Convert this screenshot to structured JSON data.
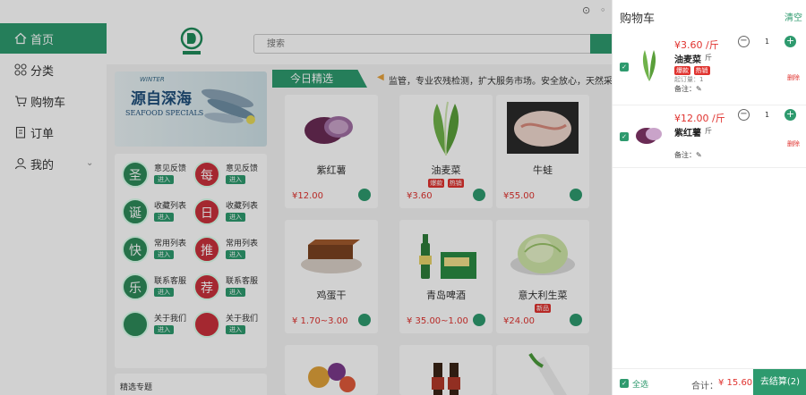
{
  "nav": {
    "items": [
      {
        "label": "首页",
        "icon": "home-icon"
      },
      {
        "label": "分类",
        "icon": "grid-icon"
      },
      {
        "label": "购物车",
        "icon": "cart-icon"
      },
      {
        "label": "订单",
        "icon": "order-icon"
      },
      {
        "label": "我的",
        "icon": "user-icon"
      }
    ]
  },
  "header": {
    "search_placeholder": "搜索"
  },
  "banner": {
    "subtitle": "WINTER",
    "title": "源自深海",
    "caption": "SEAFOOD SPECIALS"
  },
  "services": [
    {
      "label": "意见反馈",
      "char": "圣",
      "enter": "进入"
    },
    {
      "label": "意见反馈",
      "char": "每",
      "enter": "进入"
    },
    {
      "label": "收藏列表",
      "char": "诞",
      "enter": "进入"
    },
    {
      "label": "收藏列表",
      "char": "日",
      "enter": "进入"
    },
    {
      "label": "常用列表",
      "char": "快",
      "enter": "进入"
    },
    {
      "label": "常用列表",
      "char": "推",
      "enter": "进入"
    },
    {
      "label": "联系客服",
      "char": "乐",
      "enter": "进入"
    },
    {
      "label": "联系客服",
      "char": "荐",
      "enter": "进入"
    },
    {
      "label": "关于我们",
      "char": "",
      "enter": "进入"
    },
    {
      "label": "关于我们",
      "char": "",
      "enter": "进入"
    }
  ],
  "picks": {
    "title": "精选专题"
  },
  "daily": {
    "title": "今日精选",
    "notice": "监管，专业农残检测，扩大服务市场。安全放心，天然采摘"
  },
  "products": [
    {
      "name": "紫红薯",
      "price": "¥12.00",
      "badges": []
    },
    {
      "name": "油麦菜",
      "price": "¥3.60",
      "badges": [
        "爆款",
        "热销"
      ]
    },
    {
      "name": "牛蛙",
      "price": "¥55.00",
      "badges": []
    },
    {
      "name": "鸡蛋干",
      "price": "¥ 1.70~3.00",
      "badges": []
    },
    {
      "name": "青岛啤酒",
      "price": "¥ 35.00~1.00",
      "badges": []
    },
    {
      "name": "意大利生菜",
      "price": "¥24.00",
      "badges": [
        "新品"
      ]
    }
  ],
  "cart": {
    "title": "购物车",
    "clear": "清空",
    "items": [
      {
        "price": "¥3.60 /斤",
        "name": "油麦菜",
        "unit": "斤",
        "badges": [
          "爆款",
          "热销"
        ],
        "min_order": "起订量：1",
        "note": "备注：",
        "qty": "1",
        "delete": "删除"
      },
      {
        "price": "¥12.00 /斤",
        "name": "紫红薯",
        "unit": "斤",
        "badges": [],
        "min_order": "",
        "note": "备注：",
        "qty": "1",
        "delete": "删除"
      }
    ],
    "select_all": "全选",
    "total_label": "合计：",
    "total_amount": "¥ 15.60",
    "checkout": "去结算(2)"
  },
  "colors": {
    "accent": "#2e9a6e",
    "price": "#e0332f"
  }
}
